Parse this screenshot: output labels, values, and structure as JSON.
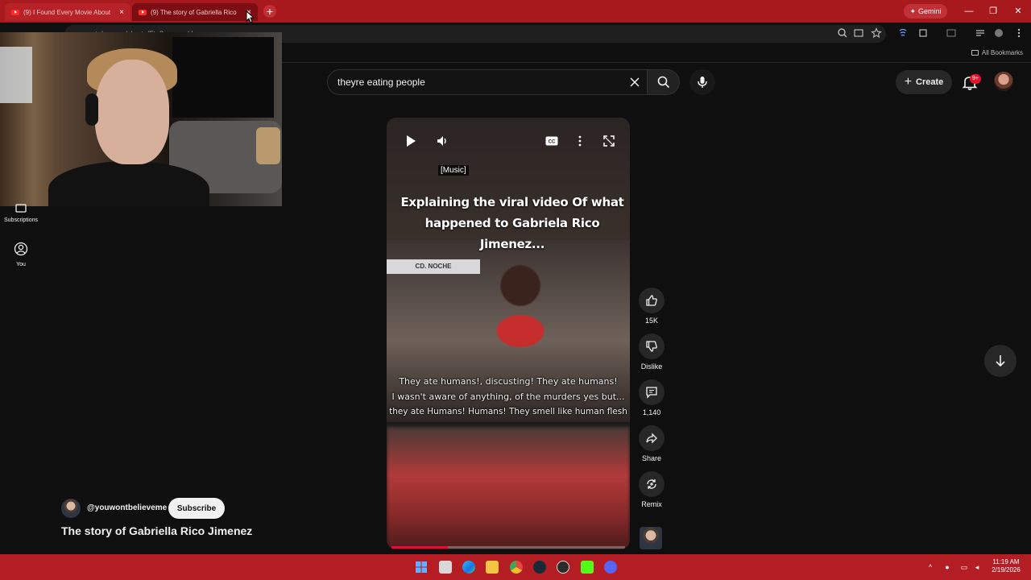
{
  "browser": {
    "tabs": [
      {
        "title": "(9) I Found Every Movie About",
        "close": "×"
      },
      {
        "title": "(9) The story of Gabriella Rico",
        "close": "×"
      }
    ],
    "new_tab": "+",
    "gemini_label": "Gemini",
    "url": "youtube.com/shorts/Fto8mpeqmU",
    "bookmarks_label": "All Bookmarks"
  },
  "youtube": {
    "search_query": "theyre eating people",
    "create_label": "Create",
    "notification_count": "9+",
    "nav": [
      {
        "label": "Subscriptions"
      },
      {
        "label": "You"
      }
    ]
  },
  "player": {
    "music_caption": "[Music]",
    "title_overlay_line1": "Explaining the viral video Of what",
    "title_overlay_line2": "happened to Gabriela Rico Jimenez...",
    "channel_bug": "CD. NOCHE",
    "subtitles": [
      "They ate humans!, discusting! They ate humans!",
      "I wasn't aware of anything, of the murders yes but...",
      "they ate Humans! Humans! They smell like human flesh"
    ],
    "progress": 0.24
  },
  "actions": {
    "likes": "15K",
    "dislike_label": "Dislike",
    "comments": "1,140",
    "share_label": "Share",
    "remix_label": "Remix"
  },
  "channel": {
    "handle": "@youwontbelieveme",
    "subscribe_label": "Subscribe"
  },
  "short": {
    "title": "The story of Gabriella Rico Jimenez"
  },
  "taskbar": {
    "time": "11:19 AM",
    "date": "2/19/2026"
  },
  "colors": {
    "tab_strip": "#a8191e",
    "taskbar": "#b51d24",
    "yt_background": "#0f0f0f",
    "progress_red": "#ff0033"
  }
}
